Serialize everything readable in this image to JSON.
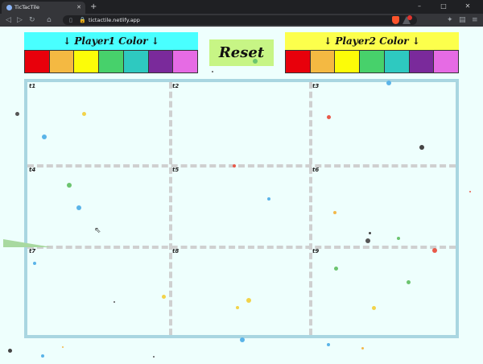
{
  "browser": {
    "tab_title": "TicTacTile",
    "new_tab": "+",
    "url": "tictactile.netlify.app",
    "window_controls": {
      "minimize": "–",
      "maximize": "□",
      "close": "✕"
    }
  },
  "player1": {
    "header": "↓ Player1 Color ↓",
    "header_bg": "#49ffff",
    "swatches": [
      "#e8000b",
      "#f4b942",
      "#fcfc08",
      "#47d16b",
      "#2ec9c0",
      "#7a2a9b",
      "#e66be4"
    ]
  },
  "player2": {
    "header": "↓ Player2 Color ↓",
    "header_bg": "#fcff4c",
    "swatches": [
      "#e8000b",
      "#f4b942",
      "#fcfc08",
      "#47d16b",
      "#2ec9c0",
      "#7a2a9b",
      "#e66be4"
    ]
  },
  "reset_label": "Reset",
  "board": {
    "cells": [
      "t1",
      "t2",
      "t3",
      "t4",
      "t5",
      "t6",
      "t7",
      "t8",
      "t9"
    ]
  },
  "colors": {
    "page_bg": "#eefffd",
    "board_border": "#a9d6e1",
    "grid_dash": "#cfd0d0",
    "reset_bg": "#c7f585"
  }
}
